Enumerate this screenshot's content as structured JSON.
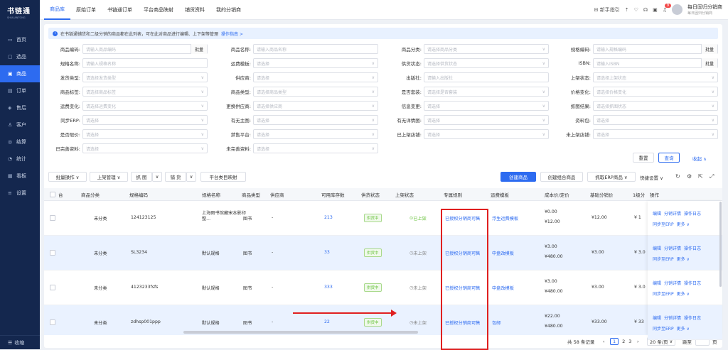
{
  "app": {
    "name": "书链通",
    "subtitle": "SHULIANTONG"
  },
  "sidebar": {
    "items": [
      {
        "label": "首页",
        "icon": "home-icon",
        "glyph": "▭"
      },
      {
        "label": "选品",
        "icon": "select-product-icon",
        "glyph": "▢"
      },
      {
        "label": "商品",
        "icon": "product-icon",
        "glyph": "▣"
      },
      {
        "label": "订单",
        "icon": "order-icon",
        "glyph": "▤"
      },
      {
        "label": "售后",
        "icon": "aftersale-icon",
        "glyph": "◈"
      },
      {
        "label": "客户",
        "icon": "customer-icon",
        "glyph": "♙"
      },
      {
        "label": "结算",
        "icon": "settlement-icon",
        "glyph": "◎"
      },
      {
        "label": "统计",
        "icon": "stats-icon",
        "glyph": "◔"
      },
      {
        "label": "看板",
        "icon": "dashboard-icon",
        "glyph": "▦"
      },
      {
        "label": "设置",
        "icon": "settings-icon",
        "glyph": "≡"
      }
    ],
    "active_index": 2,
    "bottom_label": "收缩"
  },
  "topbar": {
    "tabs": [
      "商品库",
      "原始订单",
      "书链通订单",
      "平台商品映射",
      "铺货资料",
      "我的分销商"
    ],
    "active_tab": 0,
    "guide": "新手指引",
    "notification_count": "9",
    "user_name": "每日固归分销商",
    "user_role": "每日固归分销商"
  },
  "notice": {
    "text": "在书链通铺货和二级分销的商品都在此列表，可在此对商品进行编辑、上下架等管理",
    "link": "操作指南 >"
  },
  "filters": {
    "rows": [
      [
        {
          "label": "商品编码:",
          "placeholder": "请输入商品编码",
          "batch": "批量"
        },
        {
          "label": "商品名称:",
          "placeholder": "请输入商品名称"
        },
        {
          "label": "商品分类:",
          "placeholder": "请选择商品分类",
          "select": true
        },
        {
          "label": "规格编码:",
          "placeholder": "请输入规格编码",
          "batch": "批量"
        }
      ],
      [
        {
          "label": "规格名称:",
          "placeholder": "请输入规格名称"
        },
        {
          "label": "运费模板:",
          "placeholder": "请选择",
          "select": true
        },
        {
          "label": "供货状态:",
          "placeholder": "请选择供货状态",
          "select": true
        },
        {
          "label": "ISBN:",
          "placeholder": "请输入ISBN",
          "batch": "批量"
        }
      ],
      [
        {
          "label": "发货类型:",
          "placeholder": "请选择发货类型",
          "select": true
        },
        {
          "label": "供应商:",
          "placeholder": "请选择",
          "select": true
        },
        {
          "label": "出版社:",
          "placeholder": "请输入出版社"
        },
        {
          "label": "上架状态:",
          "placeholder": "请选择上架状态",
          "select": true
        }
      ],
      [
        {
          "label": "商品标签:",
          "placeholder": "请选择商品标签",
          "select": true
        },
        {
          "label": "商品类型:",
          "placeholder": "请选择商品类型",
          "select": true
        },
        {
          "label": "是否套装:",
          "placeholder": "请选择是否套装",
          "select": true
        },
        {
          "label": "价格变化:",
          "placeholder": "请选择价格变化",
          "select": true
        }
      ],
      [
        {
          "label": "运费变化:",
          "placeholder": "请选择运费变化",
          "select": true
        },
        {
          "label": "更换供应商:",
          "placeholder": "请选择供应商",
          "select": true
        },
        {
          "label": "信息变更:",
          "placeholder": "请选择",
          "select": true
        },
        {
          "label": "抓图结果:",
          "placeholder": "请选择抓图状态",
          "select": true
        }
      ],
      [
        {
          "label": "同步ERP:",
          "placeholder": "请选择",
          "select": true
        },
        {
          "label": "有无主图:",
          "placeholder": "请选择",
          "select": true
        },
        {
          "label": "有无详情图:",
          "placeholder": "请选择",
          "select": true
        },
        {
          "label": "资料包:",
          "placeholder": "请选择",
          "select": true
        }
      ],
      [
        {
          "label": "是否限价:",
          "placeholder": "请选择",
          "select": true
        },
        {
          "label": "禁售平台:",
          "placeholder": "请选择",
          "select": true
        },
        {
          "label": "已上架店铺:",
          "placeholder": "请选择",
          "select": true
        },
        {
          "label": "未上架店铺:",
          "placeholder": "请选择",
          "select": true
        }
      ],
      [
        {
          "label": "已完善资料:",
          "placeholder": "请选择",
          "select": true
        },
        {
          "label": "未完善资料:",
          "placeholder": "请选择",
          "select": true
        }
      ]
    ],
    "reset": "重置",
    "query": "查询",
    "collapse": "收起 ∧"
  },
  "toolbar": {
    "batch": "批量操作 ∨",
    "shelve": "上架管理 ∨",
    "grab": "抓 图",
    "stock": "铺 货",
    "category_map": "平台类目映射",
    "create": "创建商品",
    "create_combo": "创建组合商品",
    "grab_erp": "抓取ERP商品 ∨",
    "quick_settings": "快捷设置 ∨"
  },
  "table": {
    "headers": [
      "台",
      "商品分类",
      "规格编码",
      "规格名称",
      "商品类型",
      "供应商",
      "可用库存数",
      "供货状态",
      "上架状态",
      "专属规则",
      "运费模板",
      "成本价/定价",
      "基础分销价",
      "1级分",
      "操作"
    ],
    "rows": [
      {
        "category": "未分类",
        "sku": "124123125",
        "spec": "上海图书馆藏宋本影印整...",
        "type": "图书",
        "supplier": "-",
        "stock": "213",
        "supply": "供货中",
        "shelf": "已上架",
        "shelf_on": true,
        "rule": "已授权分销商可售",
        "freight": "浮生运费模板",
        "cost": "¥0.00",
        "price": "¥12.00",
        "base": "¥12.00",
        "lvl": "¥ 1"
      },
      {
        "category": "未分类",
        "sku": "SL3234",
        "spec": "默认规格",
        "type": "图书",
        "supplier": "-",
        "stock": "33",
        "supply": "供货中",
        "shelf": "未上架",
        "shelf_on": false,
        "rule": "已授权分销商可售",
        "freight": "中盘改模板",
        "cost": "¥3.00",
        "price": "¥480.00",
        "base": "¥3.00",
        "lvl": "¥ 3.0"
      },
      {
        "category": "未分类",
        "sku": "4123233fsfs",
        "spec": "默认规格",
        "type": "图书",
        "supplier": "-",
        "stock": "333",
        "supply": "供货中",
        "shelf": "未上架",
        "shelf_on": false,
        "rule": "已授权分销商可售",
        "freight": "中盘改模板",
        "cost": "¥3.00",
        "price": "¥480.00",
        "base": "¥3.00",
        "lvl": "¥ 3.0"
      },
      {
        "category": "未分类",
        "sku": "zdhsp001ppp",
        "spec": "默认规格",
        "type": "图书",
        "supplier": "-",
        "stock": "22",
        "supply": "供货中",
        "shelf": "未上架",
        "shelf_on": false,
        "rule": "已授权分销商可售",
        "freight": "包邮",
        "cost": "¥22.00",
        "price": "¥480.00",
        "base": "¥33.00",
        "lvl": "¥ 33"
      }
    ],
    "ops": [
      "编辑",
      "分销详情",
      "操作日志",
      "同步至ERP",
      "更多 ∨"
    ]
  },
  "pager": {
    "total": "共 58 条记录",
    "pages": [
      "1",
      "2",
      "3"
    ],
    "current": "1",
    "per_page": "20 条/页",
    "jump": "跳至",
    "page_unit": "页"
  }
}
